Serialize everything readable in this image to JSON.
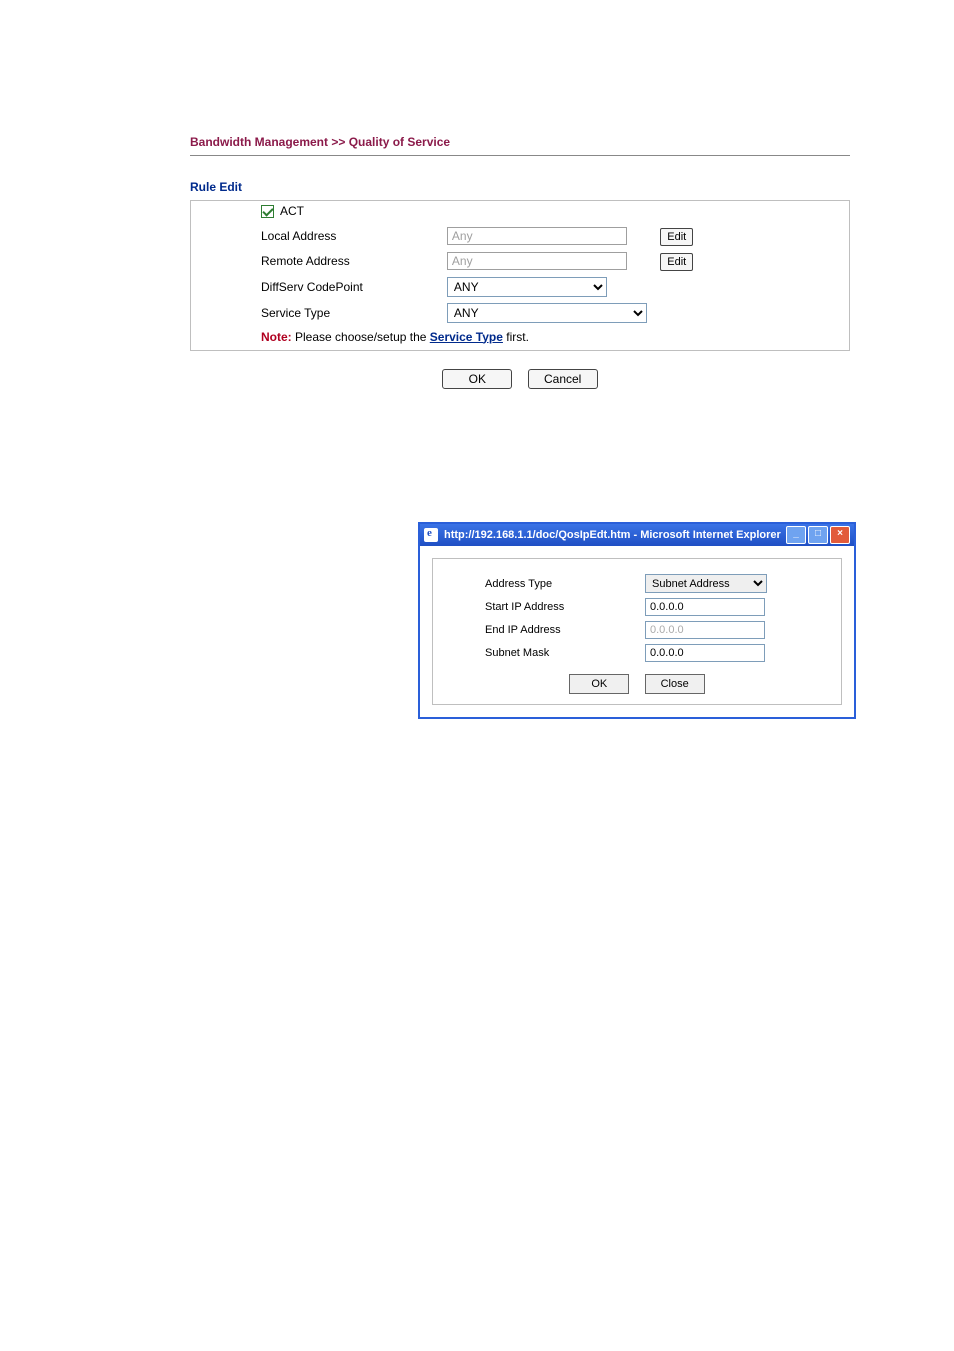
{
  "breadcrumb": "Bandwidth Management >> Quality of Service",
  "section_title": "Rule Edit",
  "form": {
    "act_label": "ACT",
    "act_checked": true,
    "local_address_label": "Local Address",
    "local_address_value": "Any",
    "local_address_edit": "Edit",
    "remote_address_label": "Remote Address",
    "remote_address_value": "Any",
    "remote_address_edit": "Edit",
    "diffserv_label": "DiffServ CodePoint",
    "diffserv_value": "ANY",
    "service_type_label": "Service Type",
    "service_type_value": "ANY",
    "note_label": "Note:",
    "note_text_pre": " Please choose/setup the ",
    "note_link": "Service Type",
    "note_text_post": " first."
  },
  "buttons": {
    "ok": "OK",
    "cancel": "Cancel"
  },
  "popup": {
    "title": "http://192.168.1.1/doc/QosIpEdt.htm - Microsoft Internet Explorer",
    "address_type_label": "Address Type",
    "address_type_value": "Subnet Address",
    "start_ip_label": "Start IP Address",
    "start_ip_value": "0.0.0.0",
    "end_ip_label": "End IP Address",
    "end_ip_value": "0.0.0.0",
    "subnet_mask_label": "Subnet Mask",
    "subnet_mask_value": "0.0.0.0",
    "ok": "OK",
    "close": "Close"
  }
}
